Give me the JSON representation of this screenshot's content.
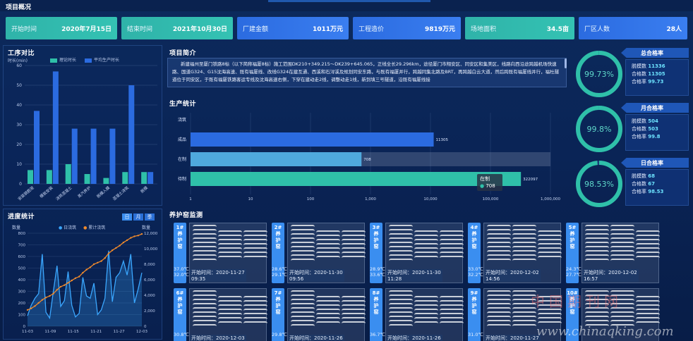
{
  "header": {
    "title": "项目概况"
  },
  "stats": [
    {
      "label": "开始时间",
      "value": "2020年7月15日",
      "color": "teal"
    },
    {
      "label": "结束时间",
      "value": "2021年10月30日",
      "color": "teal"
    },
    {
      "label": "厂建金额",
      "value": "1011万元",
      "color": "blue"
    },
    {
      "label": "工程造价",
      "value": "9819万元",
      "color": "blue"
    },
    {
      "label": "场地面积",
      "value": "34.5亩",
      "color": "teal"
    },
    {
      "label": "厂区人数",
      "value": "28人",
      "color": "blue"
    }
  ],
  "process": {
    "title": "工序对比",
    "ylabel": "时长(min)",
    "legend": [
      "理论时长",
      "平均生产时长"
    ]
  },
  "progress": {
    "title": "进度统计",
    "buttons": [
      "日",
      "月",
      "季"
    ],
    "left_label": "数量",
    "right_label": "数量",
    "legend": [
      "日浇筑",
      "累计浇筑"
    ]
  },
  "intro": {
    "title": "项目简介",
    "text": "新建福州至厦门铁路8标（以下简称福厦8标）施工范围DK210+349.215～DK239+645.065，正线全长29.296km，途径厦门市翔安区、同安区和集美区，线路向西沿途跨越机场快速路、国道G324、G15沈海高速、既有福厦线、改线G324在建互通、西溪和石浔溪及规划同安东路，与既有福厦并行，跨越同集北路及BRT，再跨越白云大道，然后跨既有福厦线并行，福杜隧道位于同安区，于既有福厦铁路客运专线及沈海高速右侧，下穿在建动走2线，调整动走1线，新到填三号隧道，沿既有福厦线接"
  },
  "production": {
    "title": "生产统计",
    "categories": [
      "浇筑",
      "成品",
      "在制",
      "待制"
    ],
    "tooltip": {
      "label": "在制",
      "value": "708"
    }
  },
  "chart_data": [
    {
      "type": "bar",
      "title": "工序对比",
      "ylabel": "时长(min)",
      "categories": [
        "安装钢筋笼",
        "模板安装",
        "浇筑混凝土",
        "蒸汽养护",
        "脱模入模",
        "混凝土浇筑",
        "脱模"
      ],
      "ylim": [
        0,
        60
      ],
      "yticks": [
        0,
        10,
        20,
        30,
        40,
        50,
        60
      ],
      "series": [
        {
          "name": "理论时长",
          "color": "#2fc0a9",
          "values": [
            7,
            7,
            10,
            5,
            3,
            6,
            6
          ]
        },
        {
          "name": "平均生产时长",
          "color": "#2b6be0",
          "values": [
            37,
            57,
            28,
            28,
            28,
            50,
            6
          ]
        }
      ]
    },
    {
      "type": "line",
      "title": "进度统计",
      "x_ticks": [
        "11-03",
        "11-09",
        "11-15",
        "11-21",
        "11-27",
        "12-03"
      ],
      "y_left": {
        "label": "数量",
        "ticks": [
          0,
          100,
          200,
          300,
          400,
          500,
          600,
          700,
          800
        ]
      },
      "y_right": {
        "label": "数量",
        "ticks": [
          0,
          2000,
          4000,
          6000,
          8000,
          10000,
          12000
        ]
      },
      "series": [
        {
          "name": "日浇筑",
          "axis": "left",
          "color": "#3aa7ff",
          "values": [
            90,
            180,
            240,
            280,
            620,
            120,
            70,
            300,
            520,
            170,
            220,
            470,
            180,
            80,
            110,
            420,
            260,
            240,
            370,
            100,
            140,
            240,
            650,
            210,
            420,
            460,
            560,
            440,
            620,
            200,
            320,
            460
          ]
        },
        {
          "name": "累计浇筑",
          "axis": "right",
          "color": "#f08a2c",
          "values": [
            2100,
            2300,
            2600,
            3000,
            3400,
            3700,
            3900,
            4200,
            4700,
            5100,
            5300,
            5600,
            5900,
            6200,
            6400,
            6900,
            7300,
            7600,
            8000,
            8200,
            8400,
            8800,
            9400,
            9800,
            10100,
            10400,
            10800,
            11100,
            11400,
            11600,
            11700,
            11900
          ]
        }
      ]
    },
    {
      "type": "bar",
      "title": "生产统计",
      "orientation": "horizontal",
      "scale": "log",
      "categories": [
        "浇筑",
        "成品",
        "在制",
        "待制"
      ],
      "values": [
        null,
        11305,
        708,
        322097
      ],
      "data_labels": [
        "",
        "11305",
        "708",
        "322097"
      ],
      "x_ticks": [
        "1",
        "10",
        "100",
        "1,000",
        "10,000",
        "100,000",
        "1,000,000"
      ],
      "xlim": [
        1,
        1000000
      ]
    }
  ],
  "rates": [
    {
      "title": "总合格率",
      "percent": "99.73%",
      "fraction": 0.9973,
      "rows": [
        {
          "label": "脱模数",
          "value": "11336"
        },
        {
          "label": "合格数",
          "value": "11305"
        },
        {
          "label": "合格率",
          "value": "99.73"
        }
      ]
    },
    {
      "title": "月合格率",
      "percent": "99.8%",
      "fraction": 0.998,
      "rows": [
        {
          "label": "脱模数",
          "value": "504"
        },
        {
          "label": "合格数",
          "value": "503"
        },
        {
          "label": "合格率",
          "value": "99.8"
        }
      ]
    },
    {
      "title": "日合格率",
      "percent": "98.53%",
      "fraction": 0.9853,
      "rows": [
        {
          "label": "脱模数",
          "value": "68"
        },
        {
          "label": "合格数",
          "value": "67"
        },
        {
          "label": "合格率",
          "value": "98.53"
        }
      ]
    }
  ],
  "kilns": {
    "title": "养护窑监测",
    "items": [
      {
        "name": "1#\n养\n护\n窑",
        "t1": "37.0℃",
        "t2": "32.0℃",
        "time": "开始时间：2020-11-27",
        "time2": "09:35"
      },
      {
        "name": "2#\n养\n护\n窑",
        "t1": "28.6℃",
        "t2": "29.1℃",
        "time": "开始时间：2020-11-30",
        "time2": "09:56"
      },
      {
        "name": "3#\n养\n护\n窑",
        "t1": "28.9℃",
        "t2": "33.6℃",
        "time": "开始时间：2020-11-30",
        "time2": "11:28"
      },
      {
        "name": "4#\n养\n护\n窑",
        "t1": "33.0℃",
        "t2": "32.2℃",
        "time": "开始时间：2020-12-02",
        "time2": "14:56"
      },
      {
        "name": "5#\n养\n护\n窑",
        "t1": "24.3℃",
        "t2": "27.7℃",
        "time": "开始时间：2020-12-02",
        "time2": "16:57"
      },
      {
        "name": "6#\n养\n护\n窑",
        "t1": "30.8℃",
        "t2": "",
        "time": "开始时间：2020-12-03",
        "time2": ""
      },
      {
        "name": "7#\n养\n护\n窑",
        "t1": "29.8℃",
        "t2": "",
        "time": "开始时间：2020-11-26",
        "time2": ""
      },
      {
        "name": "8#\n养\n护\n窑",
        "t1": "36.7℃",
        "t2": "",
        "time": "开始时间：2020-11-26",
        "time2": ""
      },
      {
        "name": "9#\n养\n护\n窑",
        "t1": "31.0℃",
        "t2": "",
        "time": "开始时间：2020-11-27",
        "time2": ""
      },
      {
        "name": "10#\n养\n护\n窑",
        "t1": "",
        "t2": "",
        "time": "",
        "time2": ""
      }
    ]
  },
  "watermark": {
    "cn": "中国期刊网",
    "url": "www.chinaqking.com"
  }
}
